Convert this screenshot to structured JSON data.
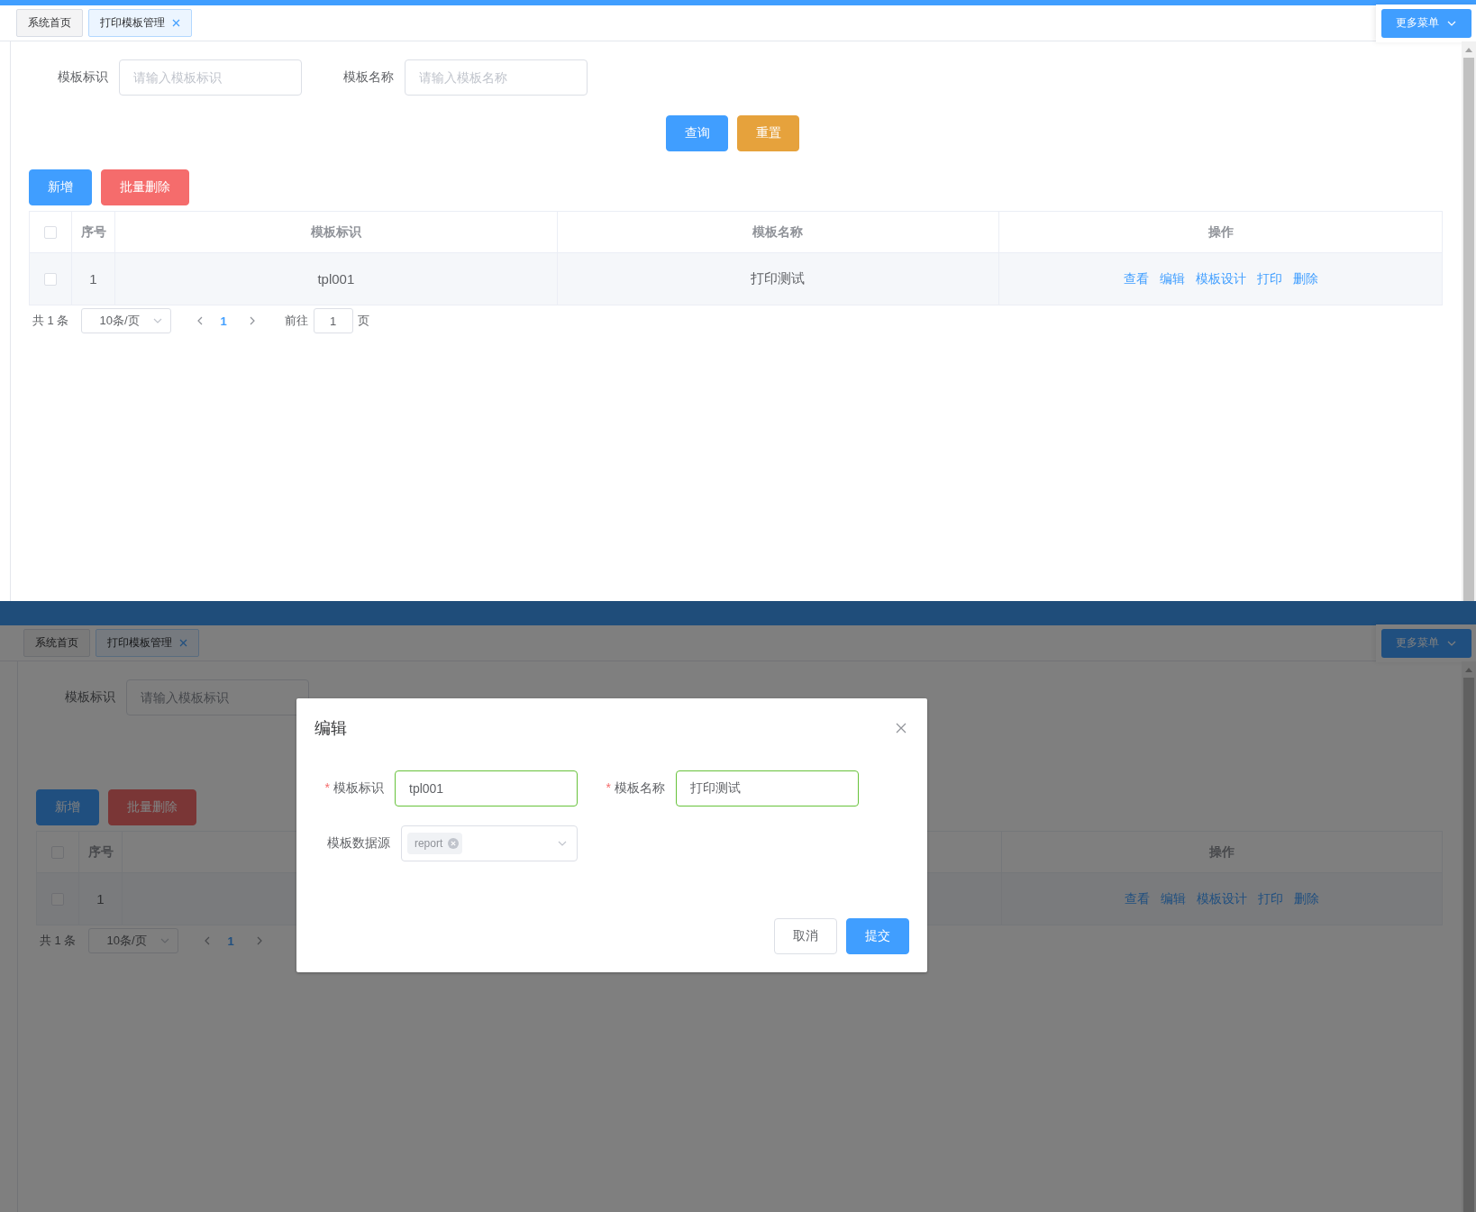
{
  "top_page": {
    "tabs": [
      {
        "label": "系统首页",
        "selected": false,
        "closable": false
      },
      {
        "label": "打印模板管理",
        "selected": true,
        "closable": true
      }
    ],
    "more_menu": "更多菜单",
    "query": {
      "fields": [
        {
          "label": "模板标识",
          "placeholder": "请输入模板标识"
        },
        {
          "label": "模板名称",
          "placeholder": "请输入模板名称"
        }
      ],
      "buttons": [
        {
          "label": "查询",
          "kind": "primary"
        },
        {
          "label": "重置",
          "kind": "warning"
        }
      ]
    },
    "toolbar": [
      {
        "label": "新增",
        "kind": "primary"
      },
      {
        "label": "批量删除",
        "kind": "danger"
      }
    ],
    "table": {
      "select_all_checked": false,
      "columns": [
        {
          "kind": "text",
          "label": "序号"
        },
        {
          "kind": "text",
          "label": "模板标识"
        },
        {
          "kind": "text",
          "label": "模板名称"
        },
        {
          "kind": "text",
          "label": "操作"
        }
      ],
      "rows": [
        {
          "checked": false,
          "cells": [
            "1",
            "tpl001",
            "打印测试"
          ],
          "actions": [
            "查看",
            "编辑",
            "模板设计",
            "打印",
            "删除"
          ]
        }
      ]
    },
    "pagination": {
      "total": "共 1 条",
      "page_size": "10条/页",
      "pages": [
        {
          "label": "1",
          "selected": true
        }
      ],
      "goto_label": "前往",
      "goto_value": "1",
      "goto_suffix": "页"
    }
  },
  "bottom_page": {
    "tabs": [
      {
        "label": "系统首页",
        "selected": false,
        "closable": false
      },
      {
        "label": "打印模板管理",
        "selected": true,
        "closable": true
      }
    ],
    "more_menu": "更多菜单",
    "query": {
      "fields": [
        {
          "label": "模板标识",
          "placeholder": "请输入模板标识"
        }
      ]
    },
    "toolbar": [
      {
        "label": "新增",
        "kind": "primary"
      },
      {
        "label": "批量删除",
        "kind": "danger"
      }
    ],
    "table": {
      "select_all_checked": false,
      "columns": [
        {
          "kind": "text",
          "label": "序号"
        },
        {
          "kind": "blank"
        },
        {
          "kind": "blank"
        },
        {
          "kind": "text",
          "label": "操作"
        }
      ],
      "rows": [
        {
          "checked": false,
          "cells": [
            "1"
          ],
          "actions": [
            "查看",
            "编辑",
            "模板设计",
            "打印",
            "删除"
          ]
        }
      ]
    },
    "pagination": {
      "total": "共 1 条",
      "page_size": "10条/页",
      "pages": [
        {
          "label": "1",
          "selected": true
        }
      ]
    }
  },
  "dialog": {
    "title": "编辑",
    "fields": [
      {
        "kind": "input",
        "required_mark": "*",
        "label": "模板标识",
        "value": "tpl001"
      },
      {
        "kind": "input",
        "required_mark": "*",
        "label": "模板名称",
        "value": "打印测试"
      },
      {
        "kind": "select",
        "label": "模板数据源",
        "tags": [
          "report"
        ]
      }
    ],
    "buttons": [
      {
        "label": "取消",
        "kind": "default"
      },
      {
        "label": "提交",
        "kind": "primary"
      }
    ]
  }
}
